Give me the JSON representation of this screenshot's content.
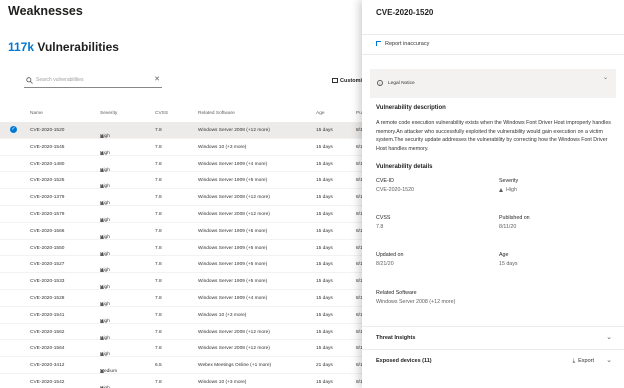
{
  "page": {
    "title": "Weaknesses",
    "vuln_count": "117k",
    "vuln_label": " Vulnerabilities"
  },
  "search": {
    "placeholder": "Search vulnerabilities"
  },
  "toolbar": {
    "customize_label": "Customize"
  },
  "table": {
    "headers": {
      "name": "Name",
      "severity": "Severity",
      "cvss": "CVSS",
      "software": "Related Software",
      "age": "Age",
      "published": "Pub"
    },
    "rows": [
      {
        "name": "CVE-2020-1520",
        "severity": "High",
        "cvss": "7.8",
        "software": "Windows Server 2008 (+12 more)",
        "age": "15 days",
        "published": "8/1",
        "selected": true
      },
      {
        "name": "CVE-2020-1545",
        "severity": "High",
        "cvss": "7.8",
        "software": "Windows 10 (+3 more)",
        "age": "15 days",
        "published": "8/1"
      },
      {
        "name": "CVE-2020-1480",
        "severity": "High",
        "cvss": "7.8",
        "software": "Windows Server 1909 (+4 more)",
        "age": "15 days",
        "published": "8/1"
      },
      {
        "name": "CVE-2020-1525",
        "severity": "High",
        "cvss": "7.8",
        "software": "Windows Server 1909 (+5 more)",
        "age": "15 days",
        "published": "8/1"
      },
      {
        "name": "CVE-2020-1379",
        "severity": "High",
        "cvss": "7.8",
        "software": "Windows Server 2008 (+12 more)",
        "age": "15 days",
        "published": "8/1"
      },
      {
        "name": "CVE-2020-1579",
        "severity": "High",
        "cvss": "7.8",
        "software": "Windows Server 2008 (+12 more)",
        "age": "15 days",
        "published": "8/1"
      },
      {
        "name": "CVE-2020-1566",
        "severity": "High",
        "cvss": "7.8",
        "software": "Windows Server 1909 (+5 more)",
        "age": "15 days",
        "published": "8/1"
      },
      {
        "name": "CVE-2020-1550",
        "severity": "High",
        "cvss": "7.8",
        "software": "Windows Server 1909 (+5 more)",
        "age": "15 days",
        "published": "8/1"
      },
      {
        "name": "CVE-2020-1527",
        "severity": "High",
        "cvss": "7.8",
        "software": "Windows Server 1909 (+5 more)",
        "age": "15 days",
        "published": "8/1"
      },
      {
        "name": "CVE-2020-1533",
        "severity": "High",
        "cvss": "7.8",
        "software": "Windows Server 1909 (+5 more)",
        "age": "15 days",
        "published": "8/1"
      },
      {
        "name": "CVE-2020-1528",
        "severity": "High",
        "cvss": "7.8",
        "software": "Windows Server 1909 (+4 more)",
        "age": "15 days",
        "published": "8/1"
      },
      {
        "name": "CVE-2020-1541",
        "severity": "High",
        "cvss": "7.8",
        "software": "Windows 10 (+3 more)",
        "age": "15 days",
        "published": "8/1"
      },
      {
        "name": "CVE-2020-1562",
        "severity": "High",
        "cvss": "7.8",
        "software": "Windows Server 2008 (+12 more)",
        "age": "15 days",
        "published": "8/1"
      },
      {
        "name": "CVE-2020-1564",
        "severity": "High",
        "cvss": "7.8",
        "software": "Windows Server 2008 (+12 more)",
        "age": "15 days",
        "published": "8/1"
      },
      {
        "name": "CVE-2020-3412",
        "severity": "Medium",
        "cvss": "6.5",
        "software": "Webex Meetings Online (+1 more)",
        "age": "21 days",
        "published": "8/1"
      },
      {
        "name": "CVE-2020-1542",
        "severity": "High",
        "cvss": "7.8",
        "software": "Windows 10 (+3 more)",
        "age": "15 days",
        "published": "8/1"
      }
    ]
  },
  "panel": {
    "title": "CVE-2020-1520",
    "report_label": "Report inaccuracy",
    "legal_notice": "Legal Notice",
    "description_heading": "Vulnerability description",
    "description": "A remote code execution vulnerability exists when the Windows Font Driver Host improperly handles memory.An attacker who successfully exploited the vulnerability would gain execution on a victim system.The security update addresses the vulnerability by correcting how the Windows Font Driver Host handles memory.",
    "details_heading": "Vulnerability details",
    "cve_id_label": "CVE-ID",
    "cve_id_value": "CVE-2020-1520",
    "severity_label": "Severity",
    "severity_value": "High",
    "cvss_label": "CVSS",
    "cvss_value": "7.8",
    "published_label": "Published on",
    "published_value": "8/11/20",
    "updated_label": "Updated on",
    "updated_value": "8/21/20",
    "age_label": "Age",
    "age_value": "15 days",
    "related_sw_label": "Related Software",
    "related_sw_value": "Windows Server 2008 (+12 more)",
    "threat_insights": "Threat Insights",
    "exposed_devices": "Exposed devices (11)",
    "export_label": "Export"
  },
  "colors": {
    "accent": "#0078d4",
    "selected_row": "#edebe9"
  }
}
